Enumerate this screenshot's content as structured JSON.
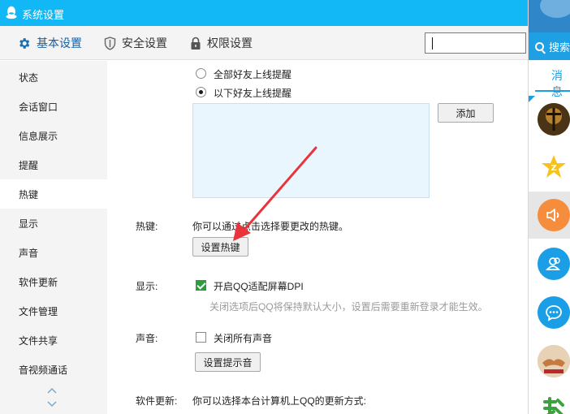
{
  "window": {
    "title": "系统设置"
  },
  "tabs": [
    {
      "label": "基本设置",
      "icon": "gear-icon"
    },
    {
      "label": "安全设置",
      "icon": "shield-icon"
    },
    {
      "label": "权限设置",
      "icon": "lock-icon"
    }
  ],
  "search": {
    "value": ""
  },
  "sidebar": {
    "items": [
      {
        "label": "状态"
      },
      {
        "label": "会话窗口"
      },
      {
        "label": "信息展示"
      },
      {
        "label": "提醒"
      },
      {
        "label": "热键",
        "active": true
      },
      {
        "label": "显示"
      },
      {
        "label": "声音"
      },
      {
        "label": "软件更新"
      },
      {
        "label": "文件管理"
      },
      {
        "label": "文件共享"
      },
      {
        "label": "音视频通话"
      }
    ]
  },
  "content": {
    "online_alert": {
      "option_all": "全部好友上线提醒",
      "option_selected": "以下好友上线提醒",
      "selected": "option_selected",
      "add_button": "添加"
    },
    "hotkey": {
      "label": "热键:",
      "description": "你可以通过点击选择要更改的热键。",
      "button": "设置热键"
    },
    "display": {
      "label": "显示:",
      "dpi_option": "开启QQ适配屏幕DPI",
      "dpi_checked": true,
      "dpi_hint": "关闭选项后QQ将保持默认大小，设置后需要重新登录才能生效。"
    },
    "sound": {
      "label": "声音:",
      "mute_option": "关闭所有声音",
      "mute_checked": false,
      "button": "设置提示音"
    },
    "update": {
      "label": "软件更新:",
      "description": "你可以选择本台计算机上QQ的更新方式:"
    }
  },
  "qq_panel": {
    "search_label": "搜索",
    "messages_tab": "消息",
    "accent_color": "#1a9ee6",
    "contacts": [
      {
        "icon": "crucifix-avatar-icon"
      },
      {
        "icon": "qzone-star-icon"
      },
      {
        "icon": "speaker-icon"
      },
      {
        "icon": "contacts-icon"
      },
      {
        "icon": "chat-bubble-icon"
      },
      {
        "icon": "handshake-avatar-icon"
      },
      {
        "icon": "green-character-avatar-icon"
      }
    ]
  },
  "colors": {
    "titlebar": "#12b7f5",
    "checkbox_checked": "#2a9d3e",
    "annotation_arrow": "#e8343a"
  }
}
